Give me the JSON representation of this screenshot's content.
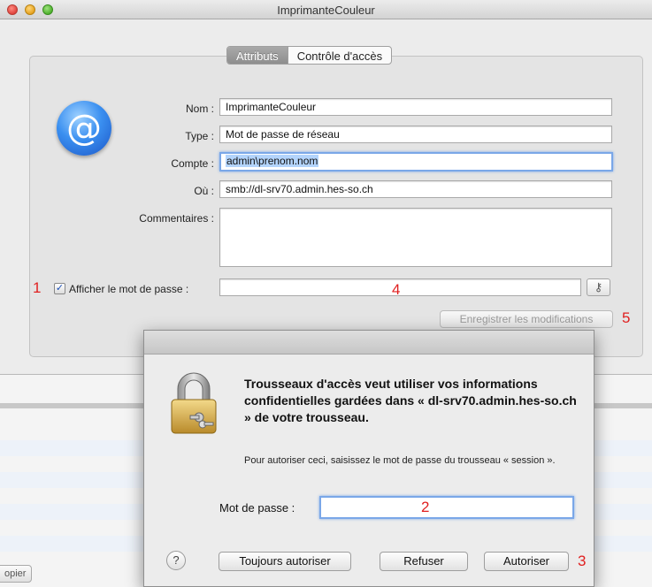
{
  "window": {
    "title": "ImprimanteCouleur"
  },
  "tabs": [
    {
      "label": "Attributs"
    },
    {
      "label": "Contrôle d'accès"
    }
  ],
  "form": {
    "name_label": "Nom :",
    "name_value": "ImprimanteCouleur",
    "type_label": "Type :",
    "type_value": "Mot de passe de réseau",
    "account_label": "Compte :",
    "account_value": "admin\\prenom.nom",
    "where_label": "Où :",
    "where_value": "smb://dl-srv70.admin.hes-so.ch",
    "comments_label": "Commentaires :",
    "comments_value": "",
    "show_password_label": "Afficher le mot de passe :",
    "show_password_checked": true,
    "password_value": "",
    "save_label": "Enregistrer les modifications"
  },
  "annotations": {
    "n1": "1",
    "n2": "2",
    "n3": "3",
    "n4": "4",
    "n5": "5"
  },
  "background": {
    "copy_button_label": "opier"
  },
  "dialog": {
    "title": "Trousseaux d'accès veut utiliser vos informations confidentielles gardées dans « dl-srv70.admin.hes-so.ch » de votre trousseau.",
    "message": "Pour autoriser ceci, saisissez le mot de passe du trousseau « session ».",
    "password_label": "Mot de passe :",
    "password_value": "",
    "help_label": "?",
    "always_allow_label": "Toujours autoriser",
    "deny_label": "Refuser",
    "allow_label": "Autoriser"
  },
  "colors": {
    "annotation": "#e02020",
    "focus_ring": "#7aa7e8",
    "selection": "#b3d4fc",
    "at_icon": "#2f7fe6"
  },
  "icons": [
    "at-sign-icon",
    "checkbox-icon",
    "key-icon",
    "lock-icon",
    "help-icon"
  ]
}
